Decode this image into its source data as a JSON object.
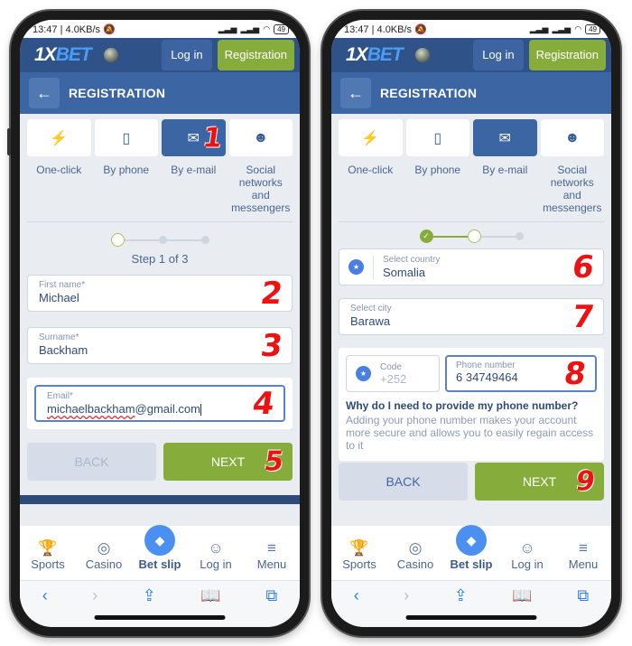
{
  "status_bar": {
    "time": "13:47",
    "speed": "4.0KB/s",
    "battery": "49"
  },
  "header": {
    "logo_one": "1X",
    "logo_bet": "BET",
    "login_label": "Log in",
    "registration_label": "Registration"
  },
  "subheader": {
    "back_icon": "←",
    "title": "REGISTRATION"
  },
  "methods": [
    {
      "label": "One-click",
      "icon": "⚡",
      "icon_name": "lightning-icon"
    },
    {
      "label": "By phone",
      "icon": "▯",
      "icon_name": "phone-icon"
    },
    {
      "label": "By e-mail",
      "icon": "✉",
      "icon_name": "envelope-icon"
    },
    {
      "label": "Social networks and messengers",
      "icon": "☻",
      "icon_name": "people-icon"
    }
  ],
  "left": {
    "step_text": "Step 1 of 3",
    "first_name": {
      "label": "First name*",
      "value": "Michael"
    },
    "surname": {
      "label": "Surname*",
      "value": "Backham"
    },
    "email": {
      "label": "Email*",
      "value_misspelled": "michaelbackham",
      "value_rest": "@gmail.com"
    },
    "back_label": "BACK",
    "next_label": "NEXT",
    "badges": [
      "1",
      "2",
      "3",
      "4",
      "5"
    ]
  },
  "right": {
    "country": {
      "label": "Select country",
      "value": "Somalia"
    },
    "city": {
      "label": "Select city",
      "value": "Barawa"
    },
    "code": {
      "label": "Code",
      "value": "+252"
    },
    "phone": {
      "label": "Phone number",
      "value": "6 34749464"
    },
    "why_question": "Why do I need to provide my phone number?",
    "why_answer": "Adding your phone number makes your account more secure and allows you to easily regain access to it",
    "back_label": "BACK",
    "next_label": "NEXT",
    "badges": [
      "6",
      "7",
      "8",
      "9"
    ]
  },
  "bottom_nav": [
    {
      "label": "Sports",
      "icon": "🏆",
      "icon_name": "trophy-icon"
    },
    {
      "label": "Casino",
      "icon": "◎",
      "icon_name": "casino-chip-icon"
    },
    {
      "label": "Bet slip",
      "icon": "◆",
      "icon_name": "ticket-icon"
    },
    {
      "label": "Log in",
      "icon": "☺",
      "icon_name": "user-icon"
    },
    {
      "label": "Menu",
      "icon": "≡",
      "icon_name": "menu-icon"
    }
  ],
  "browser_bar": {
    "back": "‹",
    "forward": "›",
    "share": "⇪",
    "bookmarks": "🕮",
    "tabs": "⧉"
  }
}
